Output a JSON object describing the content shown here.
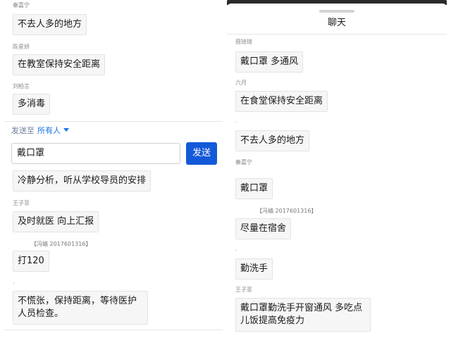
{
  "left": {
    "messages_top": [
      {
        "sender": "秦嘉宁",
        "text": "不去人多的地方"
      },
      {
        "sender": "陈星妍",
        "text": "在教室保持安全距离"
      },
      {
        "sender": "刘柏言",
        "text": "多消毒"
      }
    ],
    "send_to": {
      "label": "发送至",
      "target": "所有人"
    },
    "input_value": "戴口罩",
    "send_label": "发送",
    "messages_bottom": [
      {
        "sender": "",
        "text": "冷静分析，听从学校导员的安排"
      },
      {
        "sender": "王子菲",
        "text": "及时就医 向上汇报"
      },
      {
        "sender": "【冯嫱 2017601316】",
        "text": "打120"
      },
      {
        "sender": "·",
        "text": "不慌张，保持距离，等待医护人员检查。"
      }
    ]
  },
  "right": {
    "title": "聊天",
    "messages": [
      {
        "sender": "聂琦琦",
        "text": "戴口罩  多通风"
      },
      {
        "sender": "六月",
        "text": "在食堂保持安全距离"
      },
      {
        "sender": "·",
        "text": "不去人多的地方"
      },
      {
        "sender": "秦嘉宁",
        "text": "戴口罩"
      },
      {
        "sender": "【冯嫱 2017601316】",
        "text": "尽量在宿舍"
      },
      {
        "sender": "·",
        "text": "勤洗手"
      },
      {
        "sender": "王子菲",
        "text": "戴口罩勤洗手开窗通风 多吃点儿饭提高免疫力"
      }
    ]
  }
}
